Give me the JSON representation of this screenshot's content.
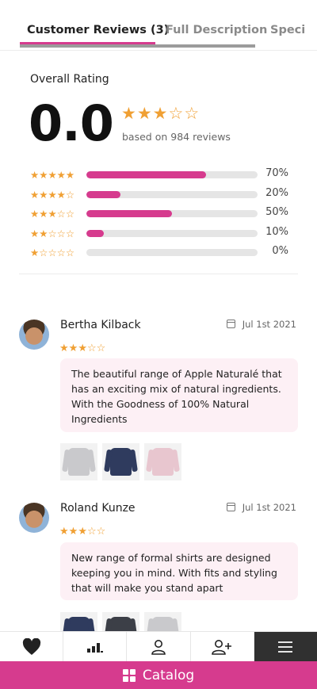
{
  "tabs": [
    {
      "label": "Customer Reviews (3)"
    },
    {
      "label": "Full Description"
    },
    {
      "label": "Speci"
    }
  ],
  "overall": {
    "label": "Overall Rating",
    "score": "0.0",
    "stars_filled": 3,
    "stars_total": 5,
    "based_on": "based on 984 reviews"
  },
  "breakdown": [
    {
      "stars": 5,
      "percent": 70,
      "percent_label": "70%"
    },
    {
      "stars": 4,
      "percent": 20,
      "percent_label": "20%"
    },
    {
      "stars": 3,
      "percent": 50,
      "percent_label": "50%"
    },
    {
      "stars": 2,
      "percent": 10,
      "percent_label": "10%"
    },
    {
      "stars": 1,
      "percent": 0,
      "percent_label": "0%"
    }
  ],
  "reviews": [
    {
      "name": "Bertha Kilback",
      "date": "Jul 1st 2021",
      "stars": 3,
      "text": "The beautiful range of Apple Naturalé that has an exciting mix of natural ingredients. With the Goodness of 100% Natural Ingredients",
      "thumbnails": [
        "grey-sweatshirt-image",
        "navy-sweatshirt-image",
        "pink-sweatshirt-image"
      ]
    },
    {
      "name": "Roland Kunze",
      "date": "Jul 1st 2021",
      "stars": 3,
      "text": "New range of formal shirts are designed keeping you in mind. With fits and styling that will make you stand apart",
      "thumbnails": [
        "navy-sweatshirt-image",
        "model-jacket-image",
        "grey-sweatshirt-image"
      ]
    }
  ],
  "bottom_nav": {
    "items": [
      "heart-icon",
      "chart-icon",
      "user-icon",
      "add-user-icon",
      "menu-icon"
    ],
    "catalog_label": "Catalog"
  },
  "colors": {
    "accent": "#d63b8e",
    "star": "#f0a034",
    "bubble": "#fdf0f5",
    "dark_nav": "#303030"
  }
}
